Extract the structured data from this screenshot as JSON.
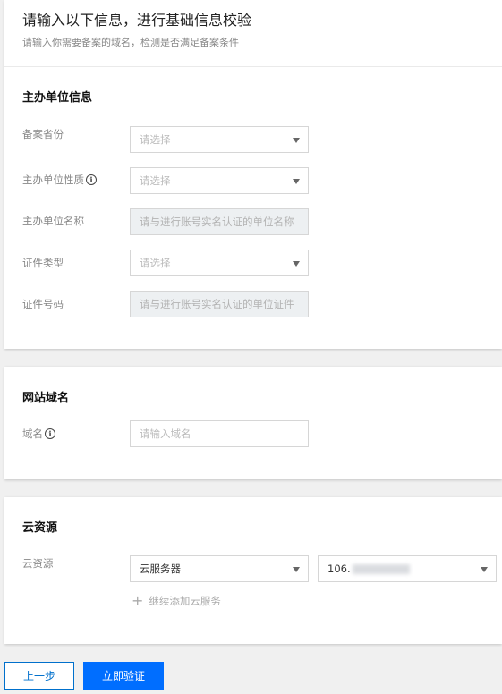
{
  "header": {
    "title": "请输入以下信息，进行基础信息校验",
    "subtitle": "请输入你需要备案的域名，检测是否满足备案条件"
  },
  "sponsor": {
    "section_title": "主办单位信息",
    "province_label": "备案省份",
    "province_placeholder": "请选择",
    "nature_label": "主办单位性质",
    "nature_placeholder": "请选择",
    "name_label": "主办单位名称",
    "name_placeholder": "请与进行账号实名认证的单位名称",
    "cert_type_label": "证件类型",
    "cert_type_placeholder": "请选择",
    "cert_no_label": "证件号码",
    "cert_no_placeholder": "请与进行账号实名认证的单位证件"
  },
  "website": {
    "section_title": "网站域名",
    "domain_label": "域名",
    "domain_placeholder": "请输入域名"
  },
  "cloud": {
    "section_title": "云资源",
    "resource_label": "云资源",
    "type_value": "云服务器",
    "ip_prefix": "106.",
    "add_label": "继续添加云服务"
  },
  "actions": {
    "prev_label": "上一步",
    "submit_label": "立即验证"
  },
  "colors": {
    "primary": "#006eff",
    "background": "#f0f0f0"
  },
  "icons": {
    "info": "info-circle-icon",
    "dropdown": "caret-down-icon",
    "add": "plus-icon"
  }
}
